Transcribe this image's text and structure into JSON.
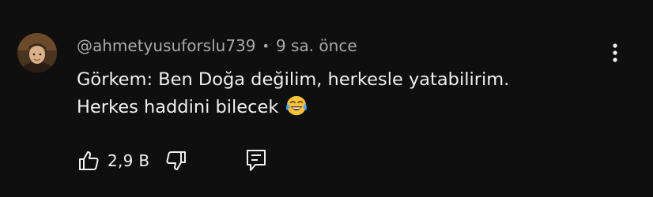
{
  "comment": {
    "author": "@ahmetyusuforslu739",
    "separator": "•",
    "time": "9 sa. önce",
    "text_line1": "Görkem: Ben Doğa değilim, herkesle yatabilirim.",
    "text_line2": "Herkes haddini bilecek",
    "emoji_icon": "face-with-tears-of-joy-icon",
    "like_count": "2,9 B"
  },
  "icons": {
    "more": "vertical-dots-icon",
    "like": "thumbs-up-icon",
    "dislike": "thumbs-down-icon",
    "reply": "reply-comment-icon"
  },
  "colors": {
    "background": "#0f0f0f",
    "text": "#f1f1f1",
    "meta": "#aaaaaa"
  }
}
